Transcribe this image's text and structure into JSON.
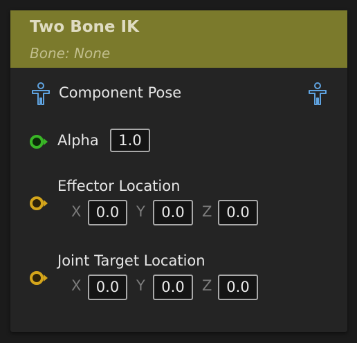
{
  "node": {
    "title": "Two Bone IK",
    "subtitle": "Bone: None",
    "header_color": "#7b7a2c"
  },
  "component_pose": {
    "label": "Component Pose",
    "icon_left": "person-icon",
    "icon_right": "person-icon",
    "icon_color": "#5fa3e0"
  },
  "alpha": {
    "label": "Alpha",
    "value": "1.0",
    "pin_color": "#39b626",
    "pin_icon": "float-pin-icon"
  },
  "effector_location": {
    "label": "Effector Location",
    "pin_color": "#d4a51b",
    "pin_icon": "vector-pin-icon",
    "x_label": "X",
    "x_value": "0.0",
    "y_label": "Y",
    "y_value": "0.0",
    "z_label": "Z",
    "z_value": "0.0"
  },
  "joint_target_location": {
    "label": "Joint Target Location",
    "pin_color": "#d4a51b",
    "pin_icon": "vector-pin-icon",
    "x_label": "X",
    "x_value": "0.0",
    "y_label": "Y",
    "y_value": "0.0",
    "z_label": "Z",
    "z_value": "0.0"
  }
}
